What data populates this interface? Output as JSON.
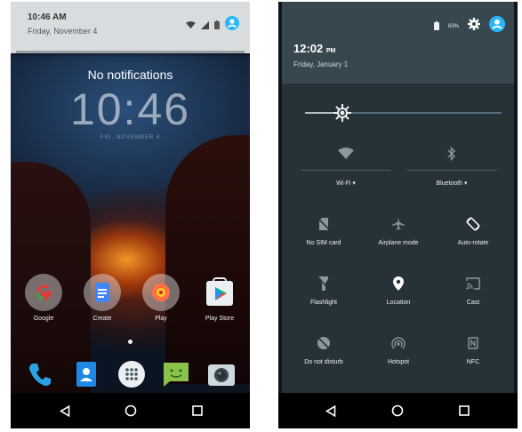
{
  "left_screen": {
    "notification_shade": {
      "time": "10:46 AM",
      "date": "Friday, November 4"
    },
    "lock": {
      "message": "No notifications",
      "clock": "10:46",
      "date_small": "FRI, NOVEMBER 4"
    },
    "apps": [
      {
        "label": "Google",
        "icon": "google-icon"
      },
      {
        "label": "Create",
        "icon": "docs-icon"
      },
      {
        "label": "Play",
        "icon": "play-music-icon"
      },
      {
        "label": "Play Store",
        "icon": "play-store-icon"
      }
    ],
    "dock": [
      "phone-icon",
      "contacts-icon",
      "app-drawer-icon",
      "messaging-icon",
      "camera-icon"
    ],
    "nav": [
      "back",
      "home",
      "recents"
    ]
  },
  "right_screen": {
    "header": {
      "time": "12:02",
      "time_suffix": "PM",
      "date": "Friday, January 1",
      "battery": "63%"
    },
    "brightness_fraction": 0.18,
    "big_tiles": [
      {
        "label": "Wi-Fi",
        "icon": "wifi-icon"
      },
      {
        "label": "Bluetooth",
        "icon": "bluetooth-icon"
      }
    ],
    "tiles": [
      {
        "label": "No SIM card",
        "icon": "no-sim-icon"
      },
      {
        "label": "Airplane mode",
        "icon": "airplane-icon"
      },
      {
        "label": "Auto-rotate",
        "icon": "auto-rotate-icon"
      },
      {
        "label": "Flashlight",
        "icon": "flashlight-icon"
      },
      {
        "label": "Location",
        "icon": "location-icon"
      },
      {
        "label": "Cast",
        "icon": "cast-icon"
      },
      {
        "label": "Do not disturb",
        "icon": "do-not-disturb-icon"
      },
      {
        "label": "Hotspot",
        "icon": "hotspot-icon"
      },
      {
        "label": "NFC",
        "icon": "nfc-icon"
      }
    ]
  },
  "colors": {
    "accent": "#29b6f6",
    "qs_panel": "#263238",
    "qs_header": "#37474f"
  }
}
